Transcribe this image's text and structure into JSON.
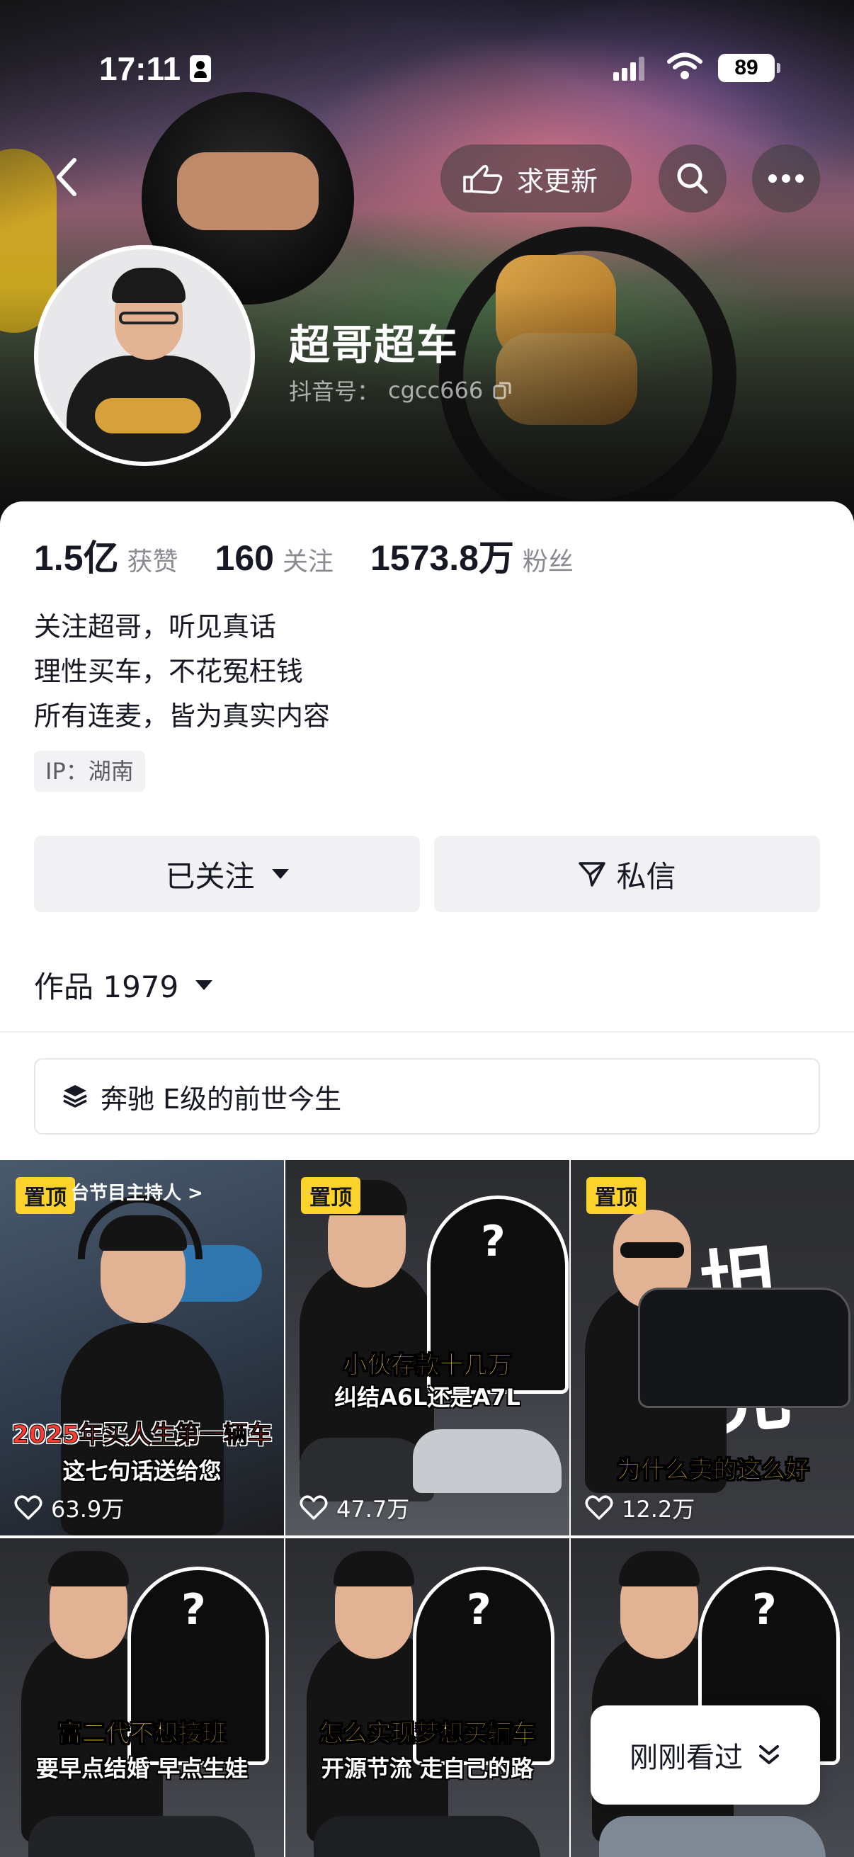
{
  "status_bar": {
    "time": "17:11",
    "battery": "89"
  },
  "header": {
    "request_update_label": "求更新"
  },
  "profile": {
    "name": "超哥超车",
    "account_label": "抖音号：",
    "account_id": "cgcc666",
    "stats": [
      {
        "value": "1.5亿",
        "label": "获赞"
      },
      {
        "value": "160",
        "label": "关注"
      },
      {
        "value": "1573.8万",
        "label": "粉丝"
      }
    ],
    "bio": [
      "关注超哥，听见真话",
      "理性买车，不花冤枉钱",
      "所有连麦，皆为真实内容"
    ],
    "ip": "IP：湖南"
  },
  "actions": {
    "follow_label": "已关注",
    "message_label": "私信"
  },
  "works": {
    "label": "作品 1979"
  },
  "collection": {
    "label": "奔驰 E级的前世今生"
  },
  "videos": [
    {
      "pinned": "置顶",
      "top_text": "台节目主持人 >",
      "caption1": "2025年买人生第一辆车",
      "caption2": "这七句话送给您",
      "likes": "63.9万"
    },
    {
      "pinned": "置顶",
      "top_text": "",
      "caption1": "小伙存款十几万",
      "caption2": "纠结A6L还是A7L",
      "likes": "47.7万"
    },
    {
      "pinned": "置顶",
      "top_text": "坦克",
      "caption1": "为什么卖的这么好",
      "caption2": "",
      "likes": "12.2万"
    },
    {
      "pinned": "",
      "top_text": "",
      "caption1": "富二代不想接班",
      "caption2": "要早点结婚 早点生娃",
      "likes": ""
    },
    {
      "pinned": "",
      "top_text": "",
      "caption1": "怎么实现梦想买辆车",
      "caption2": "开源节流 走自己的路",
      "likes": ""
    },
    {
      "pinned": "",
      "top_text": "",
      "caption1": "",
      "caption2": "",
      "likes": ""
    }
  ],
  "recent": {
    "label": "刚刚看过"
  },
  "colors": {
    "pin_yellow": "#fcd32a",
    "caption_yellow": "#ffd43a",
    "text_dark": "#161823",
    "text_gray": "#8a8b91"
  },
  "icons": [
    "back-icon",
    "hand-point-icon",
    "search-icon",
    "more-icon",
    "copy-icon",
    "caret-down-icon",
    "send-icon",
    "layers-icon",
    "heart-icon",
    "double-chevron-down-icon"
  ]
}
